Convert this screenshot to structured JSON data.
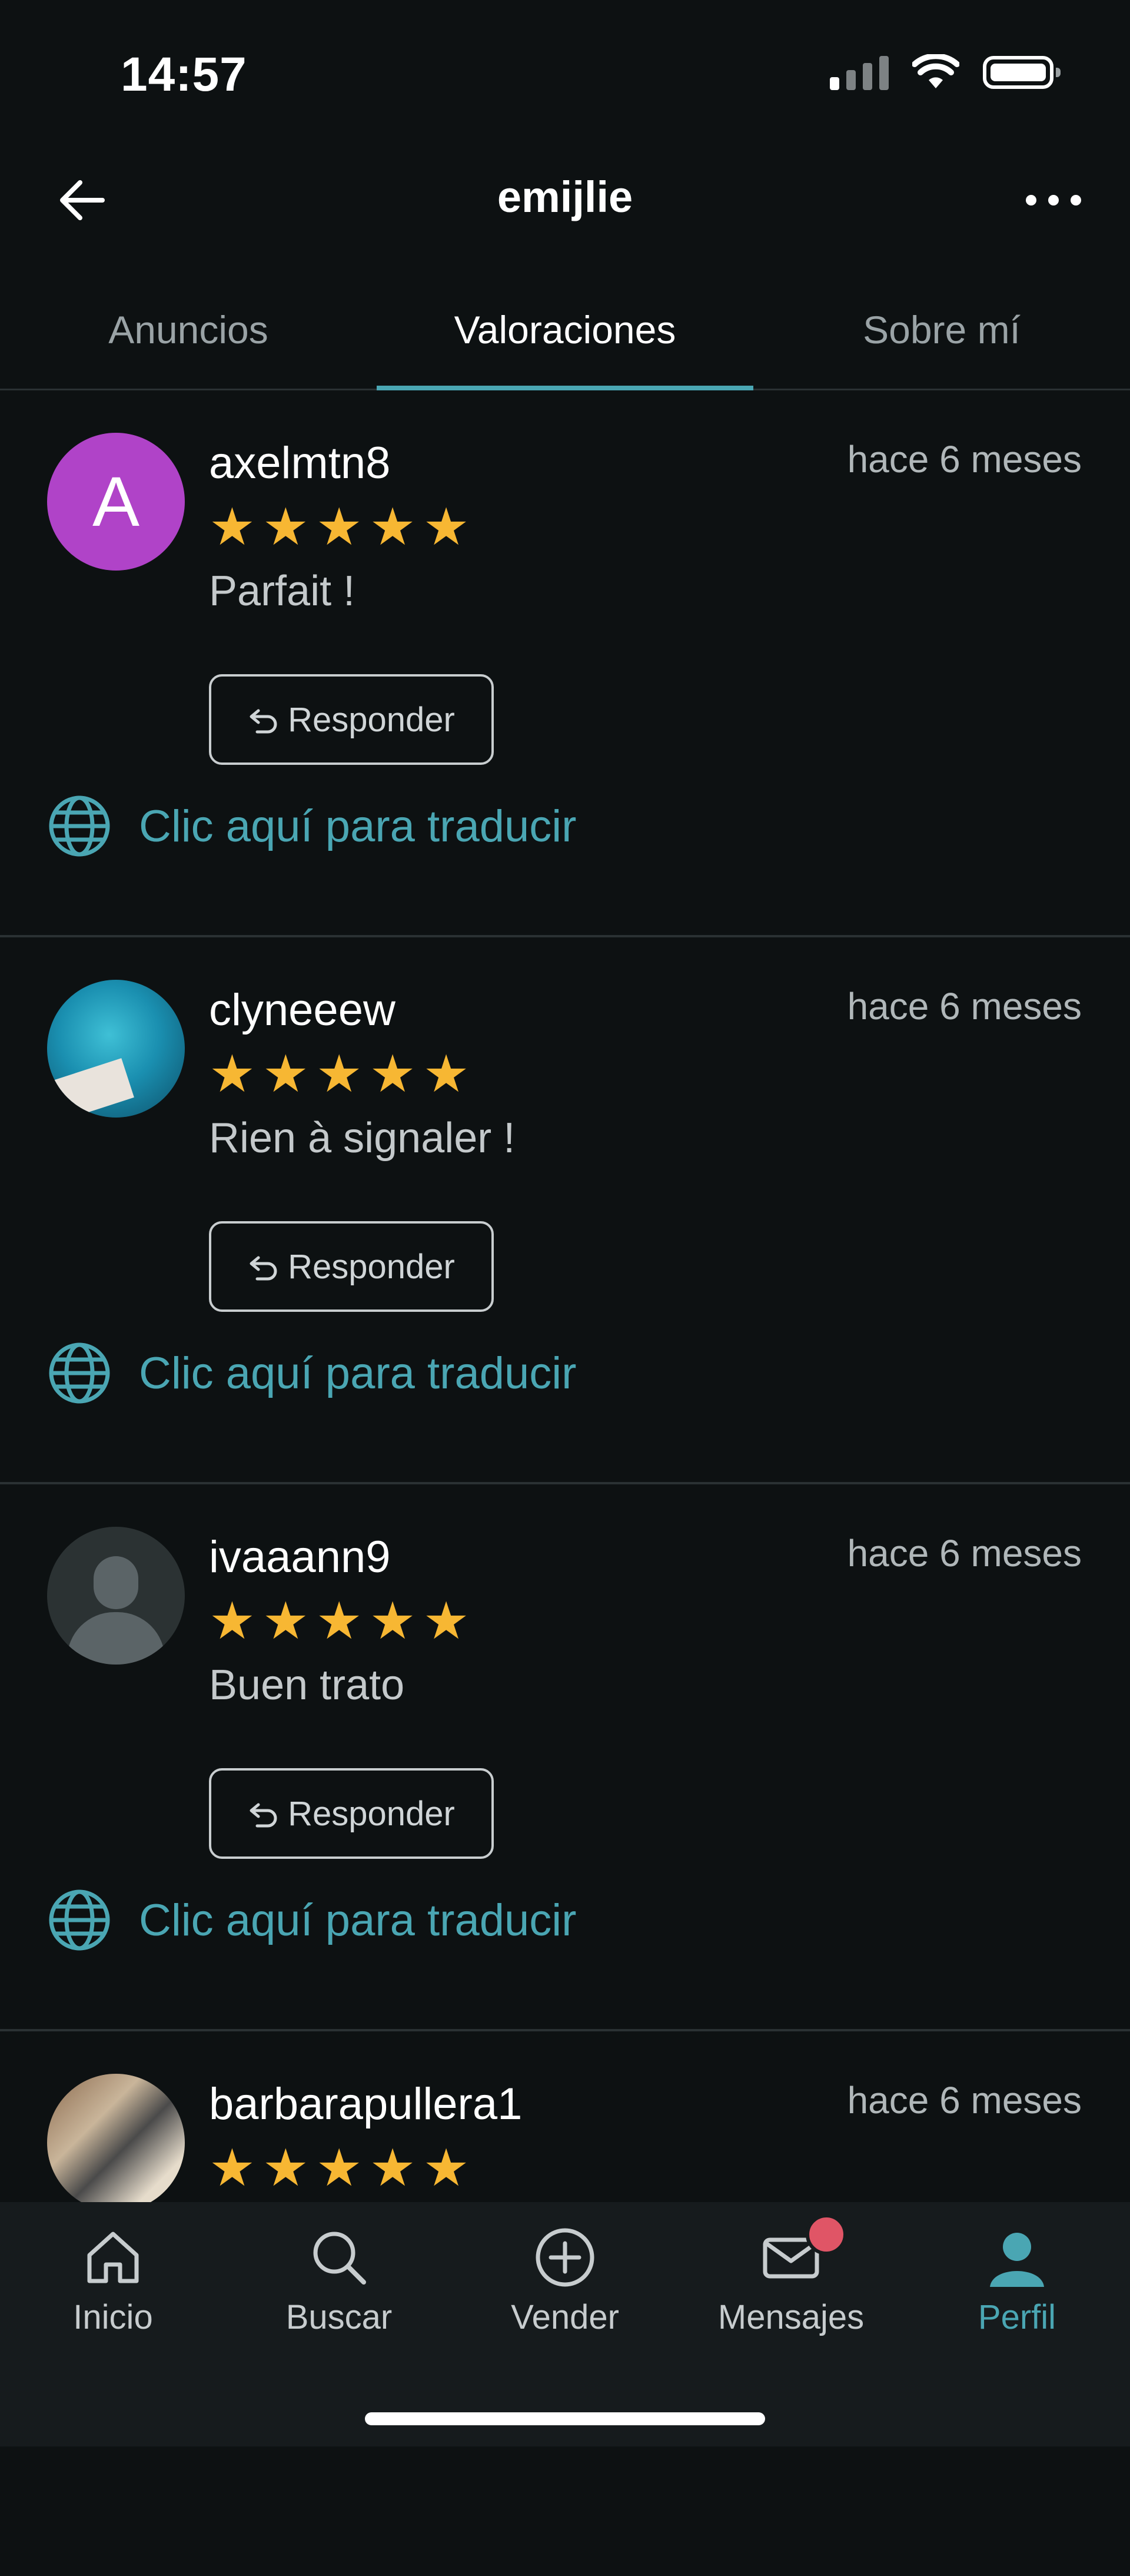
{
  "status_bar": {
    "time": "14:57"
  },
  "header": {
    "title": "emijlie"
  },
  "tabs": [
    {
      "label": "Anuncios",
      "active": false
    },
    {
      "label": "Valoraciones",
      "active": true
    },
    {
      "label": "Sobre mí",
      "active": false
    }
  ],
  "reviews": [
    {
      "username": "axelmtn8",
      "avatar_letter": "A",
      "time": "hace 6 meses",
      "rating": 5,
      "comment": "Parfait !",
      "reply_label": "Responder",
      "translate_label": "Clic aquí para traducir"
    },
    {
      "username": "clyneeew",
      "time": "hace 6 meses",
      "rating": 5,
      "comment": "Rien à signaler !",
      "reply_label": "Responder",
      "translate_label": "Clic aquí para traducir"
    },
    {
      "username": "ivaaann9",
      "time": "hace 6 meses",
      "rating": 5,
      "comment": "Buen trato",
      "reply_label": "Responder",
      "translate_label": "Clic aquí para traducir"
    },
    {
      "username": "barbarapullera1",
      "time": "hace 6 meses",
      "rating": 5
    }
  ],
  "bottom_nav": [
    {
      "label": "Inicio",
      "icon": "home-icon"
    },
    {
      "label": "Buscar",
      "icon": "search-icon"
    },
    {
      "label": "Vender",
      "icon": "plus-circle-icon"
    },
    {
      "label": "Mensajes",
      "icon": "mail-icon",
      "has_badge": true
    },
    {
      "label": "Perfil",
      "icon": "profile-icon",
      "active": true
    }
  ],
  "colors": {
    "accent": "#4aa6b3",
    "star": "#f7b733",
    "badge": "#e05566",
    "background": "#0d1112"
  }
}
